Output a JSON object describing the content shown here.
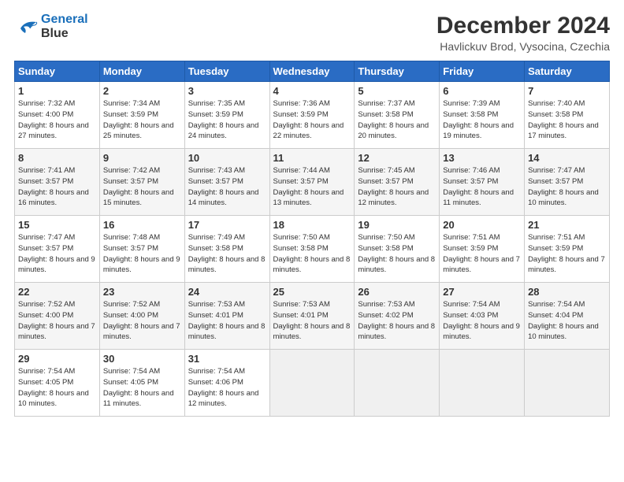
{
  "header": {
    "logo_line1": "General",
    "logo_line2": "Blue",
    "month_title": "December 2024",
    "location": "Havlickuv Brod, Vysocina, Czechia"
  },
  "days_of_week": [
    "Sunday",
    "Monday",
    "Tuesday",
    "Wednesday",
    "Thursday",
    "Friday",
    "Saturday"
  ],
  "weeks": [
    [
      {
        "day": "1",
        "sunrise": "7:32 AM",
        "sunset": "4:00 PM",
        "daylight": "8 hours and 27 minutes."
      },
      {
        "day": "2",
        "sunrise": "7:34 AM",
        "sunset": "3:59 PM",
        "daylight": "8 hours and 25 minutes."
      },
      {
        "day": "3",
        "sunrise": "7:35 AM",
        "sunset": "3:59 PM",
        "daylight": "8 hours and 24 minutes."
      },
      {
        "day": "4",
        "sunrise": "7:36 AM",
        "sunset": "3:59 PM",
        "daylight": "8 hours and 22 minutes."
      },
      {
        "day": "5",
        "sunrise": "7:37 AM",
        "sunset": "3:58 PM",
        "daylight": "8 hours and 20 minutes."
      },
      {
        "day": "6",
        "sunrise": "7:39 AM",
        "sunset": "3:58 PM",
        "daylight": "8 hours and 19 minutes."
      },
      {
        "day": "7",
        "sunrise": "7:40 AM",
        "sunset": "3:58 PM",
        "daylight": "8 hours and 17 minutes."
      }
    ],
    [
      {
        "day": "8",
        "sunrise": "7:41 AM",
        "sunset": "3:57 PM",
        "daylight": "8 hours and 16 minutes."
      },
      {
        "day": "9",
        "sunrise": "7:42 AM",
        "sunset": "3:57 PM",
        "daylight": "8 hours and 15 minutes."
      },
      {
        "day": "10",
        "sunrise": "7:43 AM",
        "sunset": "3:57 PM",
        "daylight": "8 hours and 14 minutes."
      },
      {
        "day": "11",
        "sunrise": "7:44 AM",
        "sunset": "3:57 PM",
        "daylight": "8 hours and 13 minutes."
      },
      {
        "day": "12",
        "sunrise": "7:45 AM",
        "sunset": "3:57 PM",
        "daylight": "8 hours and 12 minutes."
      },
      {
        "day": "13",
        "sunrise": "7:46 AM",
        "sunset": "3:57 PM",
        "daylight": "8 hours and 11 minutes."
      },
      {
        "day": "14",
        "sunrise": "7:47 AM",
        "sunset": "3:57 PM",
        "daylight": "8 hours and 10 minutes."
      }
    ],
    [
      {
        "day": "15",
        "sunrise": "7:47 AM",
        "sunset": "3:57 PM",
        "daylight": "8 hours and 9 minutes."
      },
      {
        "day": "16",
        "sunrise": "7:48 AM",
        "sunset": "3:57 PM",
        "daylight": "8 hours and 9 minutes."
      },
      {
        "day": "17",
        "sunrise": "7:49 AM",
        "sunset": "3:58 PM",
        "daylight": "8 hours and 8 minutes."
      },
      {
        "day": "18",
        "sunrise": "7:50 AM",
        "sunset": "3:58 PM",
        "daylight": "8 hours and 8 minutes."
      },
      {
        "day": "19",
        "sunrise": "7:50 AM",
        "sunset": "3:58 PM",
        "daylight": "8 hours and 8 minutes."
      },
      {
        "day": "20",
        "sunrise": "7:51 AM",
        "sunset": "3:59 PM",
        "daylight": "8 hours and 7 minutes."
      },
      {
        "day": "21",
        "sunrise": "7:51 AM",
        "sunset": "3:59 PM",
        "daylight": "8 hours and 7 minutes."
      }
    ],
    [
      {
        "day": "22",
        "sunrise": "7:52 AM",
        "sunset": "4:00 PM",
        "daylight": "8 hours and 7 minutes."
      },
      {
        "day": "23",
        "sunrise": "7:52 AM",
        "sunset": "4:00 PM",
        "daylight": "8 hours and 7 minutes."
      },
      {
        "day": "24",
        "sunrise": "7:53 AM",
        "sunset": "4:01 PM",
        "daylight": "8 hours and 8 minutes."
      },
      {
        "day": "25",
        "sunrise": "7:53 AM",
        "sunset": "4:01 PM",
        "daylight": "8 hours and 8 minutes."
      },
      {
        "day": "26",
        "sunrise": "7:53 AM",
        "sunset": "4:02 PM",
        "daylight": "8 hours and 8 minutes."
      },
      {
        "day": "27",
        "sunrise": "7:54 AM",
        "sunset": "4:03 PM",
        "daylight": "8 hours and 9 minutes."
      },
      {
        "day": "28",
        "sunrise": "7:54 AM",
        "sunset": "4:04 PM",
        "daylight": "8 hours and 10 minutes."
      }
    ],
    [
      {
        "day": "29",
        "sunrise": "7:54 AM",
        "sunset": "4:05 PM",
        "daylight": "8 hours and 10 minutes."
      },
      {
        "day": "30",
        "sunrise": "7:54 AM",
        "sunset": "4:05 PM",
        "daylight": "8 hours and 11 minutes."
      },
      {
        "day": "31",
        "sunrise": "7:54 AM",
        "sunset": "4:06 PM",
        "daylight": "8 hours and 12 minutes."
      },
      null,
      null,
      null,
      null
    ]
  ]
}
